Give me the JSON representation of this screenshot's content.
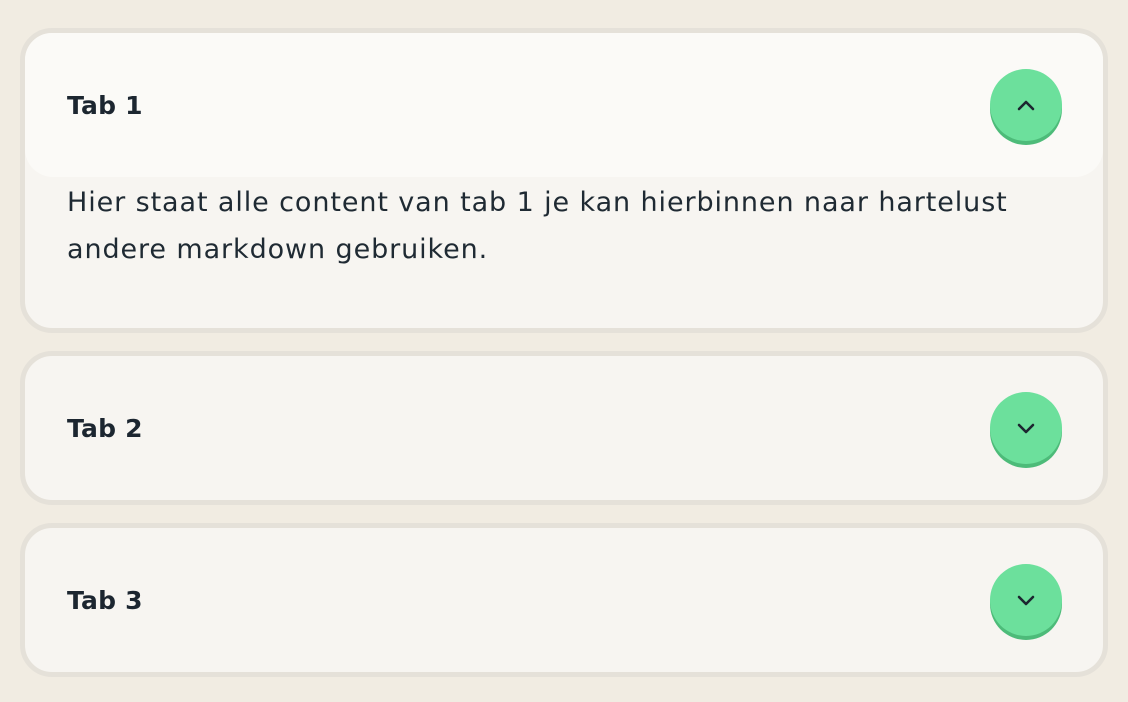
{
  "accordion": {
    "tabs": [
      {
        "label": "Tab 1",
        "expanded": true,
        "toggle_icon": "chevron-up-icon",
        "content": "Hier staat alle content van tab 1 je kan hierbinnen naar hartelust andere markdown gebruiken."
      },
      {
        "label": "Tab 2",
        "expanded": false,
        "toggle_icon": "chevron-down-icon"
      },
      {
        "label": "Tab 3",
        "expanded": false,
        "toggle_icon": "chevron-down-icon"
      }
    ]
  },
  "colors": {
    "page_background": "#f1ece2",
    "panel_background": "#f7f5f1",
    "panel_border": "#e5e1d9",
    "toggle_background": "#6ce09c",
    "text": "#1c2630"
  }
}
